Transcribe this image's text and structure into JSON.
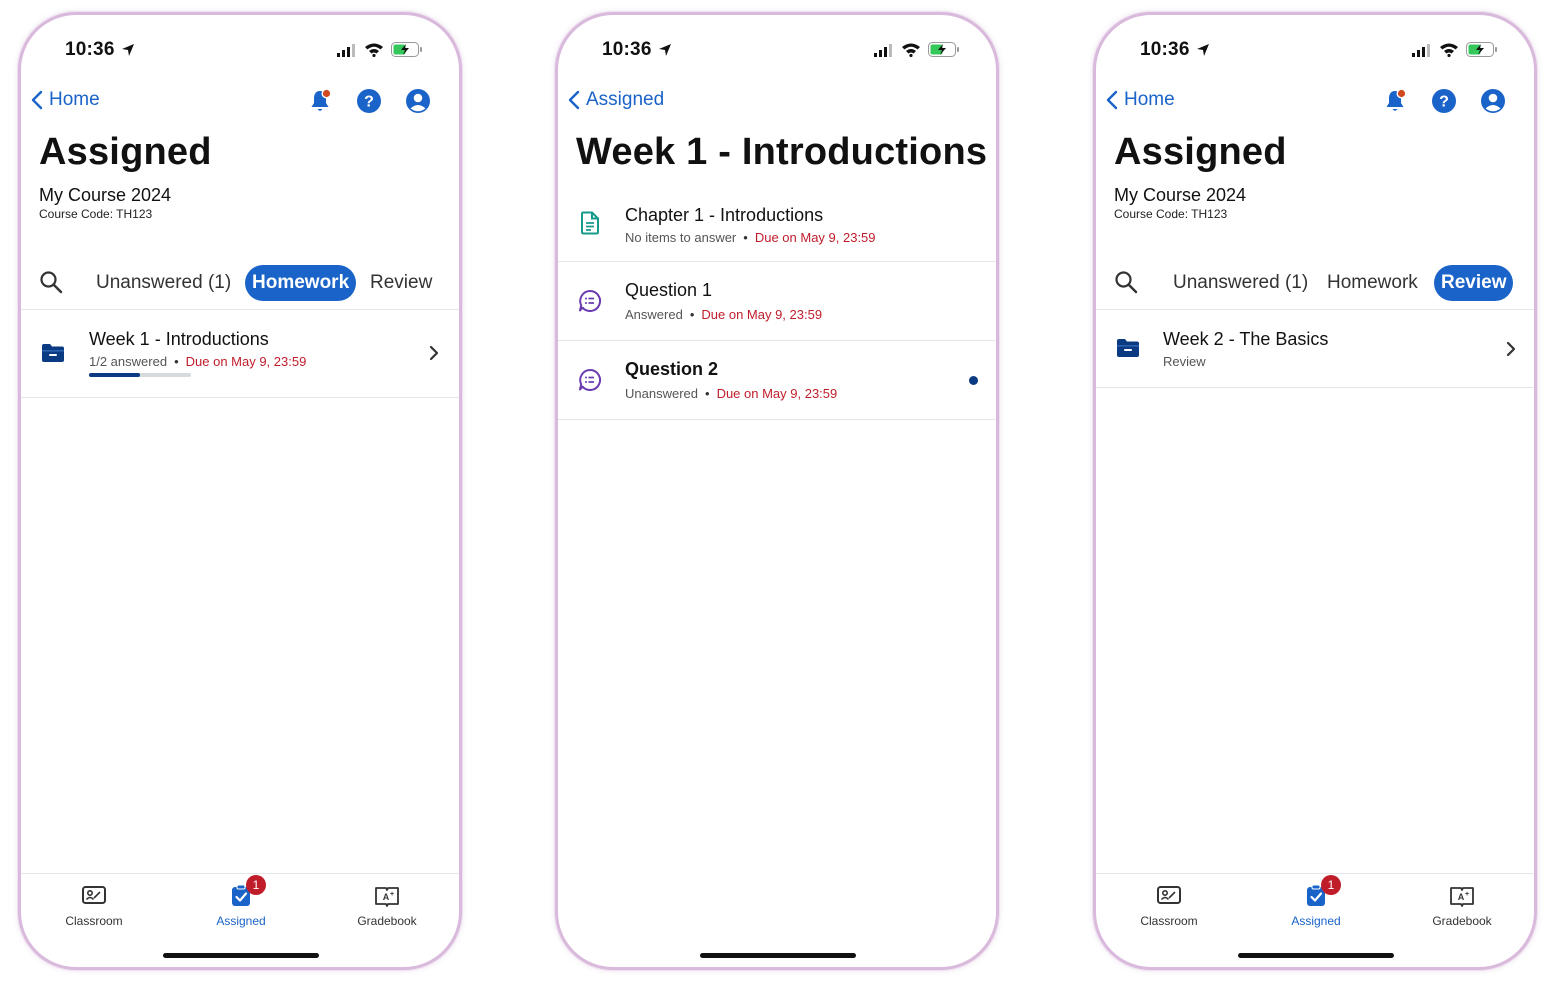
{
  "colors": {
    "accent": "#1a63c8",
    "due_red": "#c01d2b",
    "navy": "#0a3a82",
    "phone_frame": "#d9b9dc"
  },
  "screen1": {
    "status": {
      "time": "10:36"
    },
    "nav": {
      "back_label": "Home",
      "icons": [
        "bell-icon",
        "help-icon",
        "account-icon"
      ]
    },
    "title": "Assigned",
    "course": {
      "name": "My Course 2024",
      "code": "Course Code: TH123"
    },
    "tabs": [
      "Unanswered (1)",
      "Homework",
      "Review"
    ],
    "active_tab": "Homework",
    "items": [
      {
        "title": "Week 1 - Introductions",
        "status": "1/2 answered",
        "due": "Due on May 9, 23:59",
        "progress": 0.5,
        "icon": "folder-icon"
      }
    ],
    "tabbar": {
      "items": [
        "Classroom",
        "Assigned",
        "Gradebook"
      ],
      "active": "Assigned",
      "badge": "1"
    }
  },
  "screen2": {
    "status": {
      "time": "10:36"
    },
    "nav": {
      "back_label": "Assigned"
    },
    "title": "Week 1 - Introductions",
    "items": [
      {
        "title": "Chapter 1 - Introductions",
        "status": "No items to answer",
        "due": "Due on May 9, 23:59",
        "icon": "document-icon",
        "unread": false
      },
      {
        "title": "Question 1",
        "status": "Answered",
        "due": "Due on May 9, 23:59",
        "icon": "question-icon",
        "unread": false
      },
      {
        "title": "Question 2",
        "status": "Unanswered",
        "due": "Due on May 9, 23:59",
        "icon": "question-icon",
        "unread": true
      }
    ]
  },
  "screen3": {
    "status": {
      "time": "10:36"
    },
    "nav": {
      "back_label": "Home",
      "icons": [
        "bell-icon",
        "help-icon",
        "account-icon"
      ]
    },
    "title": "Assigned",
    "course": {
      "name": "My Course 2024",
      "code": "Course Code: TH123"
    },
    "tabs": [
      "Unanswered (1)",
      "Homework",
      "Review"
    ],
    "active_tab": "Review",
    "items": [
      {
        "title": "Week 2 - The Basics",
        "status": "Review",
        "icon": "folder-icon"
      }
    ],
    "tabbar": {
      "items": [
        "Classroom",
        "Assigned",
        "Gradebook"
      ],
      "active": "Assigned",
      "badge": "1"
    }
  }
}
